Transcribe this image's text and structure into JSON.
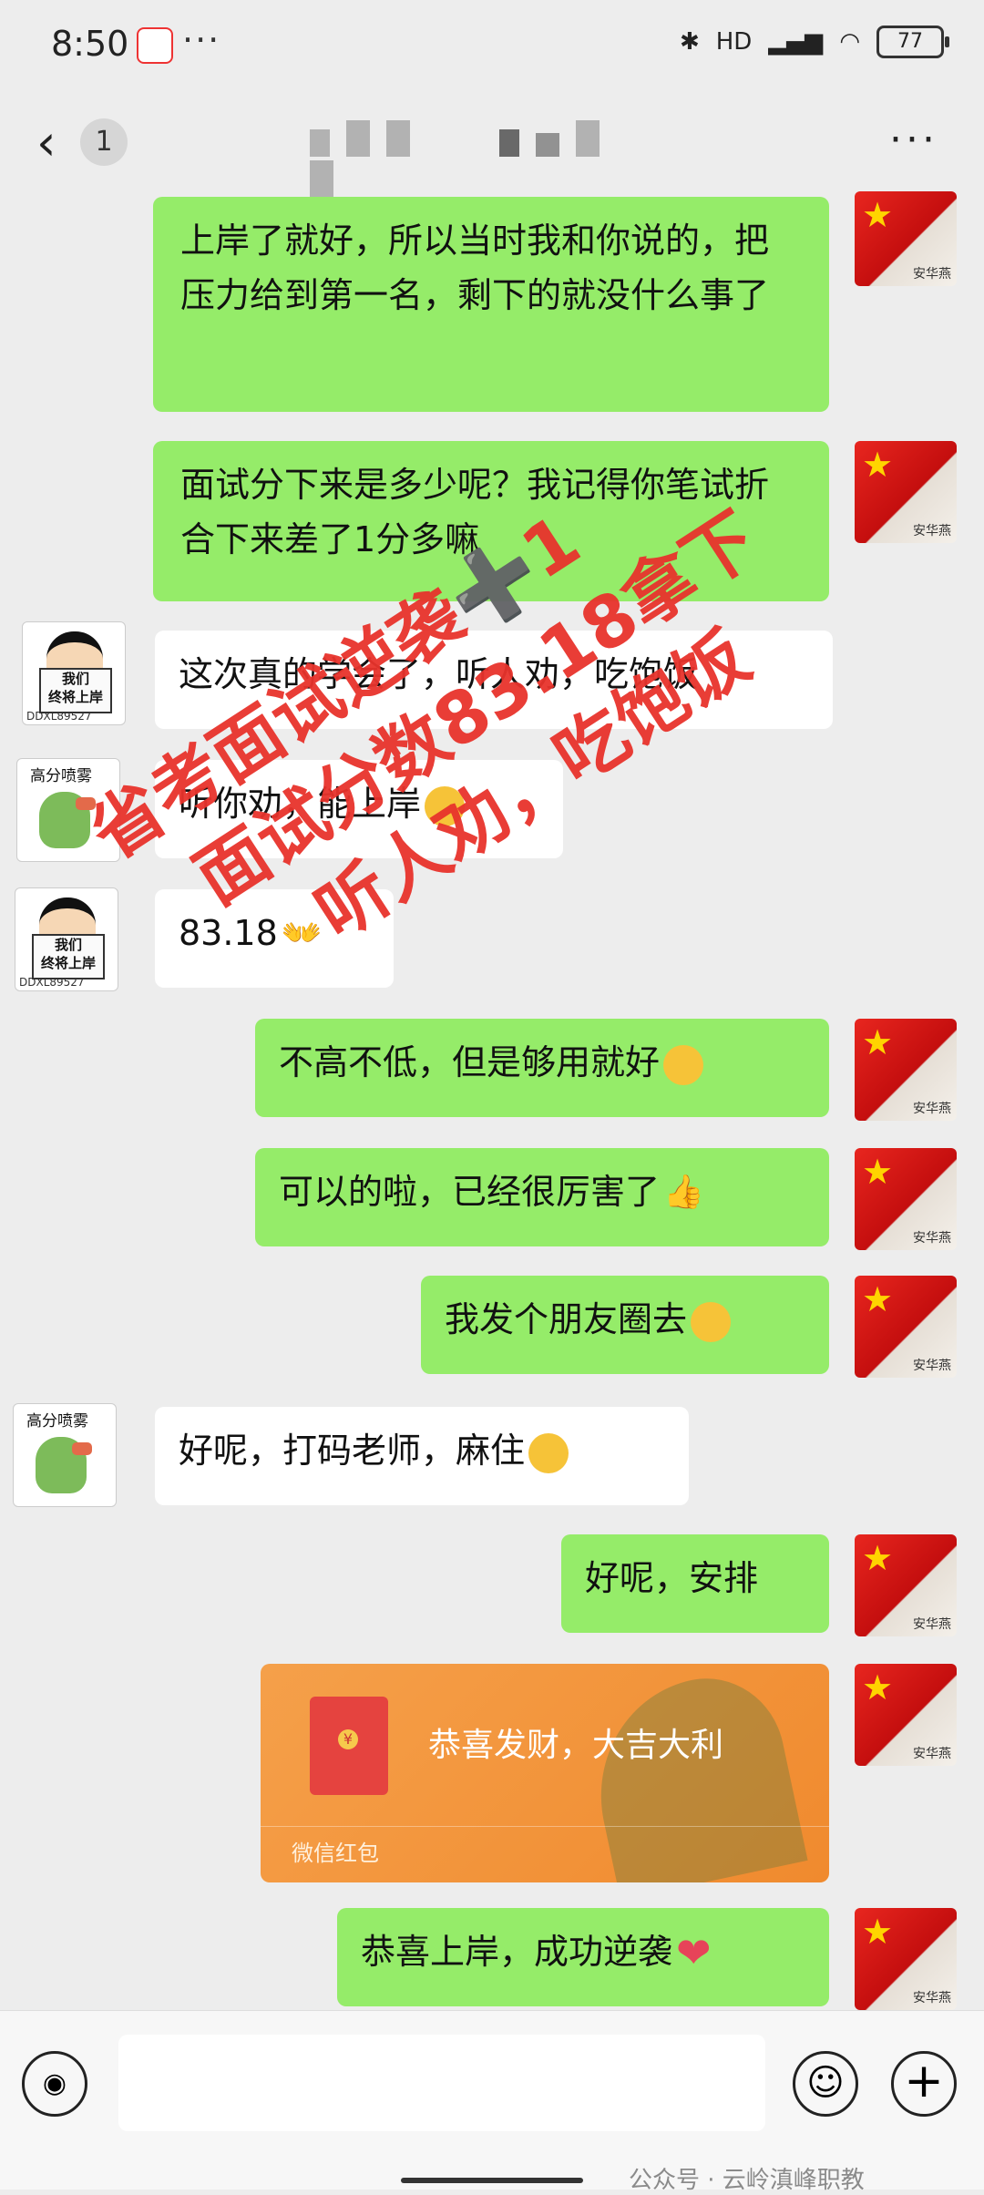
{
  "status_bar": {
    "time": "8:50",
    "battery": "77",
    "network": "HD",
    "dots": "···"
  },
  "header": {
    "back_glyph": "‹",
    "unread_count": "1",
    "more_glyph": "···"
  },
  "messages": [
    {
      "from": "me",
      "text": "上岸了就好，所以当时我和你说的，把压力给到第一名，剩下的就没什么事了"
    },
    {
      "from": "me",
      "text": "面试分下来是多少呢？我记得你笔试折合下来差了1分多嘛"
    },
    {
      "from": "other",
      "text": "这次真的学会了，听人劝，吃饱饭"
    },
    {
      "from": "other",
      "text": "听你劝，能上岸"
    },
    {
      "from": "other",
      "text": "83.18"
    },
    {
      "from": "me",
      "text": "不高不低，但是够用就好"
    },
    {
      "from": "me",
      "text": "可以的啦，已经很厉害了"
    },
    {
      "from": "me",
      "text": "我发个朋友圈去"
    },
    {
      "from": "other",
      "text": "好呢，打码老师，麻住"
    },
    {
      "from": "me",
      "text": "好呢，安排"
    },
    {
      "from": "me",
      "text": "恭喜上岸，成功逆袭"
    }
  ],
  "red_packet": {
    "title": "恭喜发财，大吉大利",
    "footer": "微信红包"
  },
  "avatars": {
    "shin_sign": "我们\n终将上岸",
    "shin_id": "DDXL89527",
    "dino_label": "高分喷雾",
    "me_sig": "安华燕"
  },
  "watermark": {
    "line1": "省考面试逆袭➕1",
    "line2": "面试分数83.18拿下",
    "line3": "听人劝，吃饱饭"
  },
  "footer_watermark": "公众号 · 云岭滇峰职教",
  "colors": {
    "my_bubble": "#95ec69",
    "other_bubble": "#ffffff",
    "background": "#ededed",
    "watermark": "#e8332c"
  }
}
